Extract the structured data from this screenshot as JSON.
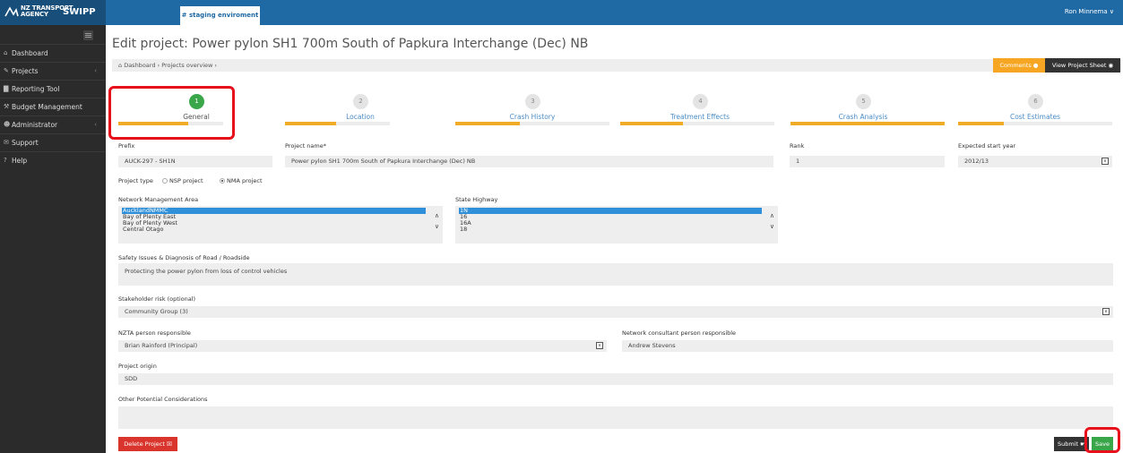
{
  "header": {
    "logo_lines": [
      "NZ TRANSPORT",
      "AGENCY"
    ],
    "app_name": "SWIPP",
    "env_tab": "# staging enviroment",
    "user": "Ron Minnema ∨"
  },
  "sidebar": {
    "items": [
      {
        "icon": "⌂",
        "label": "Dashboard"
      },
      {
        "icon": "✎",
        "label": "Projects",
        "chevron": "‹"
      },
      {
        "icon": "▇",
        "label": "Reporting Tool"
      },
      {
        "icon": "⚒",
        "label": "Budget Management"
      },
      {
        "icon": "☻",
        "label": "Administrator",
        "chevron": "‹"
      },
      {
        "icon": "✉",
        "label": "Support"
      },
      {
        "icon": "?",
        "label": "Help"
      }
    ]
  },
  "main": {
    "title": "Edit project: Power pylon SH1 700m South of Papkura Interchange (Dec) NB",
    "breadcrumb": "⌂ Dashboard › Projects overview ›",
    "comments_label": "Comments ●",
    "view_sheet_label": "View Project Sheet ◉",
    "steps": [
      {
        "num": "1",
        "label": "General"
      },
      {
        "num": "2",
        "label": "Location"
      },
      {
        "num": "3",
        "label": "Crash History"
      },
      {
        "num": "4",
        "label": "Treatment Effects"
      },
      {
        "num": "5",
        "label": "Crash Analysis"
      },
      {
        "num": "6",
        "label": "Cost Estimates"
      }
    ],
    "active_step": 1,
    "form": {
      "prefix_label": "Prefix",
      "prefix_value": "AUCK-297 - SH1N",
      "project_name_label": "Project name*",
      "project_name_value": "Power pylon SH1 700m South of Papkura Interchange (Dec) NB",
      "rank_label": "Rank",
      "rank_value": "1",
      "start_year_label": "Expected start year",
      "start_year_value": "2012/13",
      "project_type_label": "Project type",
      "type_options": [
        "NSP project",
        "NMA project"
      ],
      "type_selected": "NMA project",
      "nma_label": "Network Management Area",
      "nma_options": [
        "AucklandNMMC",
        "Bay of Plenty East",
        "Bay of Plenty West",
        "Central Otago"
      ],
      "sh_label": "State Highway",
      "sh_options": [
        "1N",
        "16",
        "16A",
        "18"
      ],
      "safety_label": "Safety Issues & Diagnosis of Road / Roadside",
      "safety_value": "Protecting the power pylon from loss of control vehicles",
      "stakeholder_label": "Stakeholder risk (optional)",
      "stakeholder_value": "Community Group (3)",
      "nzta_label": "NZTA person responsible",
      "nzta_value": "Brian Rainford (Principal)",
      "consultant_label": "Network consultant person responsible",
      "consultant_value": "Andrew Stevens",
      "origin_label": "Project origin",
      "origin_value": "SDD",
      "other_label": "Other Potential Considerations",
      "other_value": ""
    },
    "delete_label": "Delete Project ☒",
    "submit_label": "Submit ☛",
    "save_label": "Save"
  },
  "colors": {
    "topbar": "#1f6aa5",
    "sidebar": "#2b2b2b",
    "step_active": "#3aa64a",
    "progress": "#f0ac27",
    "highlight": "#e8101a",
    "delete": "#d9352d",
    "save": "#3aa64a",
    "comments": "#f6a623"
  }
}
